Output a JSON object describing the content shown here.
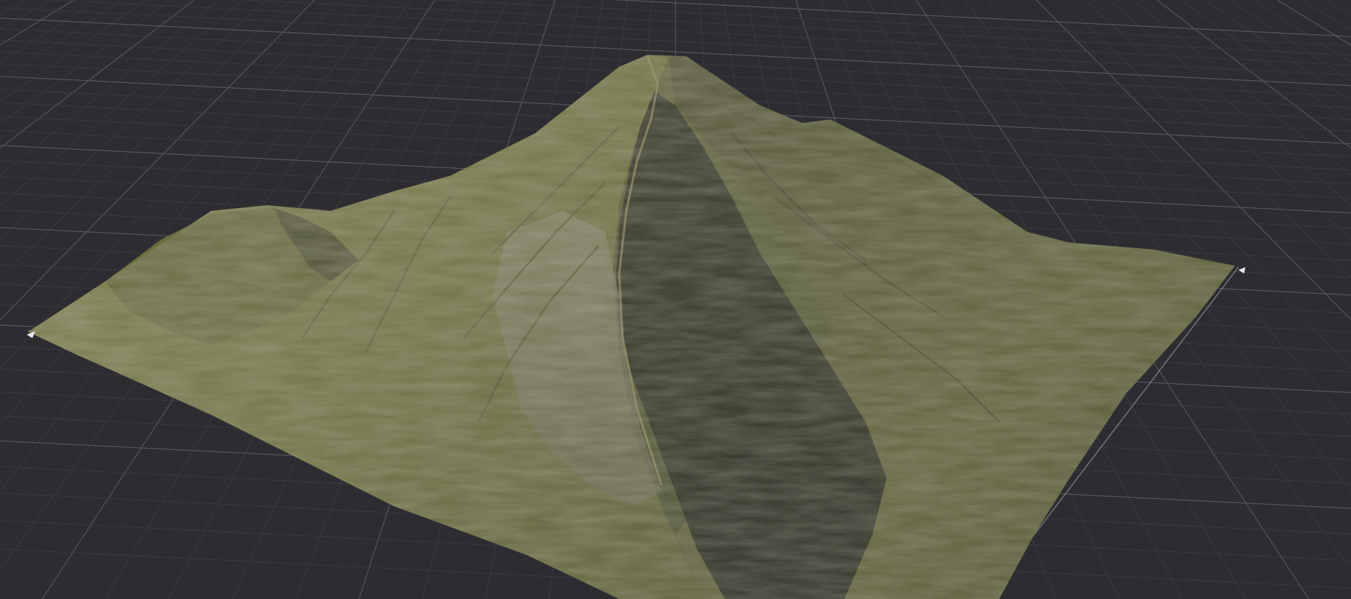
{
  "viewport": {
    "name": "3d-viewport",
    "background_color": "#2d2d31",
    "grid": {
      "visible": true,
      "major_line_color": "#5a5a60",
      "minor_line_color": "#3c3c41",
      "perspective": true
    },
    "object": {
      "type": "terrain-mesh",
      "name": "terrain",
      "features": [
        "main-peak",
        "secondary-peak",
        "ridge",
        "cliff-face",
        "shadowed-slope"
      ],
      "colors": {
        "grass_light": "#8a8a4f",
        "grass_mid": "#6d6e3b",
        "grass_dark": "#4a4d28",
        "rock": "#8e8c7c",
        "shadow": "#26281b"
      }
    },
    "markers": {
      "left_corner_icon": "corner-marker-icon",
      "right_corner_icon": "corner-marker-icon"
    }
  }
}
